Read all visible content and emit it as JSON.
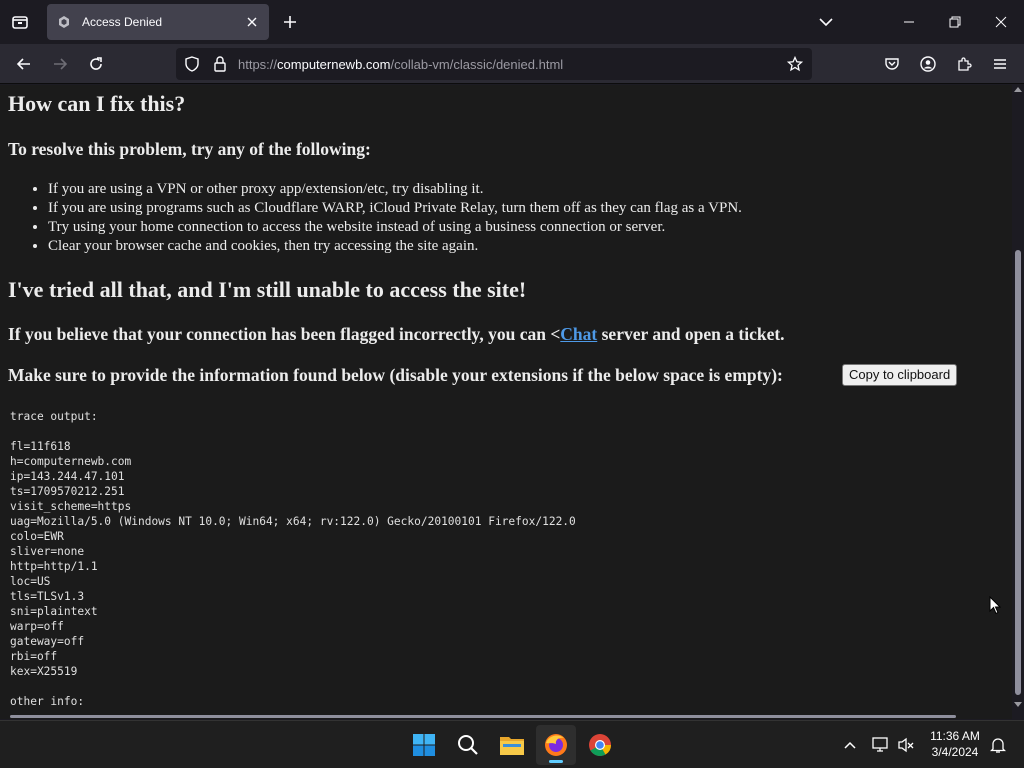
{
  "browser": {
    "tab_title": "Access Denied",
    "url_prefix": "https://",
    "url_domain": "computernewb.com",
    "url_path": "/collab-vm/classic/denied.html"
  },
  "page": {
    "heading_fix": "How can I fix this?",
    "subheading_resolve": "To resolve this problem, try any of the following:",
    "tips": [
      "If you are using a VPN or other proxy app/extension/etc, try disabling it.",
      "If you are using programs such as Cloudflare WARP, iCloud Private Relay, turn them off as they can flag as a VPN.",
      "Try using your home connection to access the website instead of using a business connection or server.",
      "Clear your browser cache and cookies, then try accessing the site again."
    ],
    "heading_still": "I've tried all that, and I'm still unable to access the site!",
    "flagged_before": "If you believe that your connection has been flagged incorrectly, you can <",
    "flagged_link": "Chat",
    "flagged_after": " server and open a ticket.",
    "provide_info": "Make sure to provide the information found below (disable your extensions if the below space is empty):",
    "copy_button": "Copy to clipboard",
    "trace_text": "trace output:\n\nfl=11f618\nh=computernewb.com\nip=143.244.47.101\nts=1709570212.251\nvisit_scheme=https\nuag=Mozilla/5.0 (Windows NT 10.0; Win64; x64; rv:122.0) Gecko/20100101 Firefox/122.0\ncolo=EWR\nsliver=none\nhttp=http/1.1\nloc=US\ntls=TLSv1.3\nsni=plaintext\nwarp=off\ngateway=off\nrbi=off\nkex=X25519\n\nother info:"
  },
  "taskbar": {
    "time": "11:36 AM",
    "date": "3/4/2024",
    "apps": [
      "windows-start",
      "search",
      "file-explorer",
      "firefox",
      "chrome"
    ]
  },
  "colors": {
    "link": "#4e9ae8",
    "page_bg": "#1b1b1b",
    "tab_active": "#42414d",
    "taskbar_accent": "#60cdff"
  }
}
